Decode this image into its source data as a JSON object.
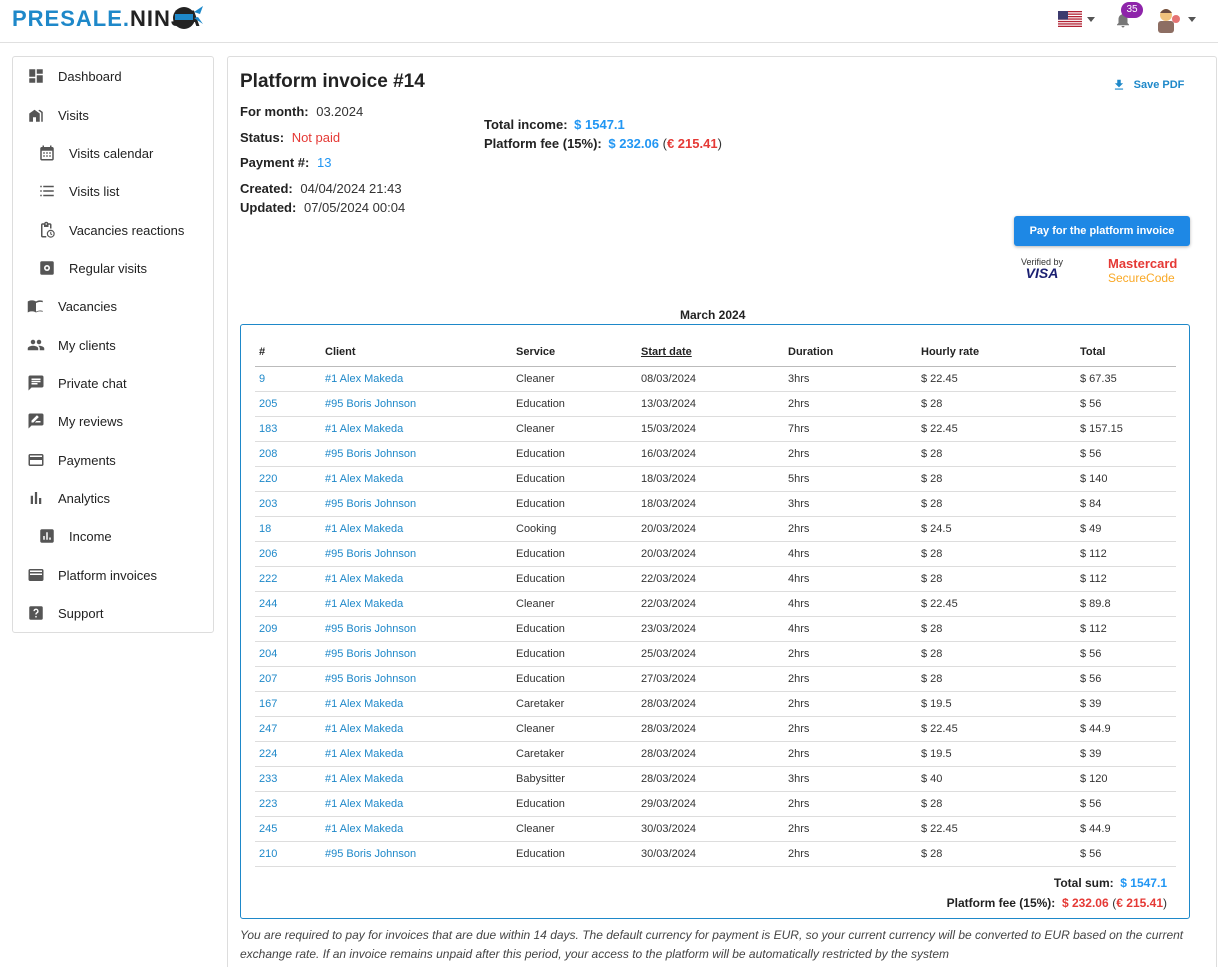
{
  "header": {
    "logo_main": "PRESALE",
    "logo_dot": ".",
    "logo_ninja": "NINJA",
    "notifications_count": "35"
  },
  "sidebar": {
    "items": [
      {
        "label": "Dashboard",
        "icon": "dashboard-icon"
      },
      {
        "label": "Visits",
        "icon": "home-icon"
      },
      {
        "label": "Visits calendar",
        "icon": "calendar-icon"
      },
      {
        "label": "Visits list",
        "icon": "list-icon"
      },
      {
        "label": "Vacancies reactions",
        "icon": "clipboard-clock-icon"
      },
      {
        "label": "Regular visits",
        "icon": "settings-box-icon"
      },
      {
        "label": "Vacancies",
        "icon": "book-icon"
      },
      {
        "label": "My clients",
        "icon": "people-icon"
      },
      {
        "label": "Private chat",
        "icon": "chat-icon"
      },
      {
        "label": "My reviews",
        "icon": "rate-review-icon"
      },
      {
        "label": "Payments",
        "icon": "credit-card-icon"
      },
      {
        "label": "Analytics",
        "icon": "bar-chart-icon"
      },
      {
        "label": "Income",
        "icon": "insights-icon"
      },
      {
        "label": "Platform invoices",
        "icon": "wallet-icon"
      },
      {
        "label": "Support",
        "icon": "help-icon"
      }
    ]
  },
  "invoice": {
    "title": "Platform invoice #14",
    "save_pdf": "Save PDF",
    "for_month_label": "For month:",
    "for_month": "03.2024",
    "status_label": "Status:",
    "status": "Not paid",
    "payment_label": "Payment #:",
    "payment": "13",
    "created_label": "Created:",
    "created": "04/04/2024 21:43",
    "updated_label": "Updated:",
    "updated": "07/05/2024 00:04",
    "total_income_label": "Total income:",
    "total_income": "$ 1547.1",
    "platform_fee_label": "Platform fee (15%):",
    "platform_fee": "$ 232.06",
    "platform_fee_eur": "€ 215.41",
    "pay_button": "Pay for the platform invoice",
    "verified_by": "Verified by",
    "visa": "VISA",
    "mastercard": "Mastercard",
    "securecode": "SecureCode",
    "month_title": "March 2024"
  },
  "table": {
    "headers": [
      "#",
      "Client",
      "Service",
      "Start date",
      "Duration",
      "Hourly rate",
      "Total"
    ],
    "rows": [
      [
        "9",
        "#1 Alex Makeda",
        "Cleaner",
        "08/03/2024",
        "3hrs",
        "$ 22.45",
        "$ 67.35"
      ],
      [
        "205",
        "#95 Boris Johnson",
        "Education",
        "13/03/2024",
        "2hrs",
        "$ 28",
        "$ 56"
      ],
      [
        "183",
        "#1 Alex Makeda",
        "Cleaner",
        "15/03/2024",
        "7hrs",
        "$ 22.45",
        "$ 157.15"
      ],
      [
        "208",
        "#95 Boris Johnson",
        "Education",
        "16/03/2024",
        "2hrs",
        "$ 28",
        "$ 56"
      ],
      [
        "220",
        "#1 Alex Makeda",
        "Education",
        "18/03/2024",
        "5hrs",
        "$ 28",
        "$ 140"
      ],
      [
        "203",
        "#95 Boris Johnson",
        "Education",
        "18/03/2024",
        "3hrs",
        "$ 28",
        "$ 84"
      ],
      [
        "18",
        "#1 Alex Makeda",
        "Cooking",
        "20/03/2024",
        "2hrs",
        "$ 24.5",
        "$ 49"
      ],
      [
        "206",
        "#95 Boris Johnson",
        "Education",
        "20/03/2024",
        "4hrs",
        "$ 28",
        "$ 112"
      ],
      [
        "222",
        "#1 Alex Makeda",
        "Education",
        "22/03/2024",
        "4hrs",
        "$ 28",
        "$ 112"
      ],
      [
        "244",
        "#1 Alex Makeda",
        "Cleaner",
        "22/03/2024",
        "4hrs",
        "$ 22.45",
        "$ 89.8"
      ],
      [
        "209",
        "#95 Boris Johnson",
        "Education",
        "23/03/2024",
        "4hrs",
        "$ 28",
        "$ 112"
      ],
      [
        "204",
        "#95 Boris Johnson",
        "Education",
        "25/03/2024",
        "2hrs",
        "$ 28",
        "$ 56"
      ],
      [
        "207",
        "#95 Boris Johnson",
        "Education",
        "27/03/2024",
        "2hrs",
        "$ 28",
        "$ 56"
      ],
      [
        "167",
        "#1 Alex Makeda",
        "Caretaker",
        "28/03/2024",
        "2hrs",
        "$ 19.5",
        "$ 39"
      ],
      [
        "247",
        "#1 Alex Makeda",
        "Cleaner",
        "28/03/2024",
        "2hrs",
        "$ 22.45",
        "$ 44.9"
      ],
      [
        "224",
        "#1 Alex Makeda",
        "Caretaker",
        "28/03/2024",
        "2hrs",
        "$ 19.5",
        "$ 39"
      ],
      [
        "233",
        "#1 Alex Makeda",
        "Babysitter",
        "28/03/2024",
        "3hrs",
        "$ 40",
        "$ 120"
      ],
      [
        "223",
        "#1 Alex Makeda",
        "Education",
        "29/03/2024",
        "2hrs",
        "$ 28",
        "$ 56"
      ],
      [
        "245",
        "#1 Alex Makeda",
        "Cleaner",
        "30/03/2024",
        "2hrs",
        "$ 22.45",
        "$ 44.9"
      ],
      [
        "210",
        "#95 Boris Johnson",
        "Education",
        "30/03/2024",
        "2hrs",
        "$ 28",
        "$ 56"
      ]
    ],
    "total_sum_label": "Total sum:",
    "total_sum": "$ 1547.1",
    "fee_label": "Platform fee (15%):",
    "fee": "$ 232.06",
    "fee_eur": "€ 215.41"
  },
  "footnote": "You are required to pay for invoices that are due within 14 days. The default currency for payment is EUR, so your current currency will be converted to EUR based on the current exchange rate. If an invoice remains unpaid after this period, your access to the platform will be automatically restricted by the system"
}
